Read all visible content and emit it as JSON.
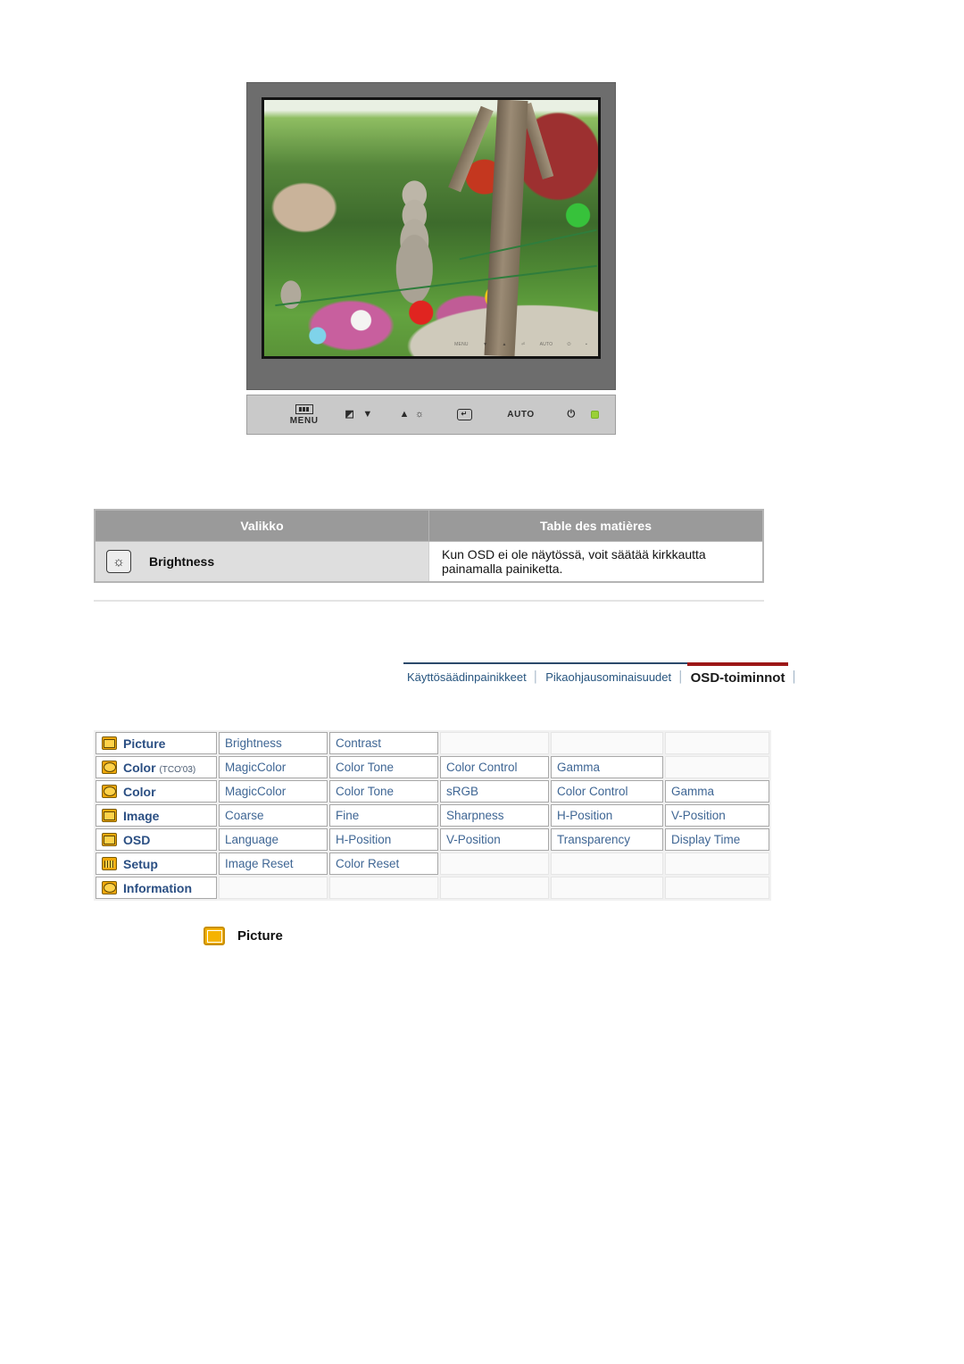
{
  "monitor": {
    "panel_buttons": [
      {
        "label": "MENU",
        "icon": "menu-bars-icon"
      },
      {
        "label": "",
        "icon": "source-down-arrow-icon"
      },
      {
        "label": "",
        "icon": "up-arrow-brightness-icon"
      },
      {
        "label": "",
        "icon": "enter-icon"
      },
      {
        "label": "AUTO",
        "icon": "auto-label"
      },
      {
        "label": "",
        "icon": "power-icon"
      },
      {
        "label": "",
        "icon": "power-led-indicator"
      }
    ],
    "auto_label": "AUTO",
    "menu_label": "MENU",
    "enter_glyph": "↵",
    "power_glyph": "⏻",
    "down_arrow_glyph": "▼",
    "up_arrow_glyph": "▲",
    "brightness_glyph": "☼",
    "source_glyph": "◩",
    "inline_controls": [
      "MENU",
      "▼",
      "▲",
      "⏎",
      "AUTO",
      "⏻",
      "▪"
    ]
  },
  "summary_table": {
    "headers": {
      "menu": "Valikko",
      "description": "Table des matières"
    },
    "rows": [
      {
        "icon": "brightness-icon",
        "icon_glyph": "☼",
        "label": "Brightness",
        "description": "Kun OSD ei ole näytössä, voit säätää kirkkautta painamalla painiketta."
      }
    ]
  },
  "breadcrumb": {
    "items": [
      {
        "label": "Käyttösäädinpainikkeet",
        "active": false
      },
      {
        "label": "Pikaohjausominaisuudet",
        "active": false
      },
      {
        "label": "OSD-toiminnot",
        "active": true
      }
    ],
    "separator": "│",
    "accent_color": "#9c1717",
    "link_color": "#27557f"
  },
  "osd_table": {
    "rows": [
      {
        "icon": "picture-icon",
        "label": "Picture",
        "suffix": "",
        "items": [
          "Brightness",
          "Contrast",
          "",
          "",
          ""
        ]
      },
      {
        "icon": "color-icon",
        "label": "Color",
        "suffix": "(TCO'03)",
        "items": [
          "MagicColor",
          "Color Tone",
          "Color Control",
          "Gamma",
          ""
        ]
      },
      {
        "icon": "color-icon",
        "label": "Color",
        "suffix": "",
        "items": [
          "MagicColor",
          "Color Tone",
          "sRGB",
          "Color Control",
          "Gamma"
        ]
      },
      {
        "icon": "image-icon",
        "label": "Image",
        "suffix": "",
        "items": [
          "Coarse",
          "Fine",
          "Sharpness",
          "H-Position",
          "V-Position"
        ]
      },
      {
        "icon": "osd-icon",
        "label": "OSD",
        "suffix": "",
        "items": [
          "Language",
          "H-Position",
          "V-Position",
          "Transparency",
          "Display Time"
        ]
      },
      {
        "icon": "setup-icon",
        "label": "Setup",
        "suffix": "",
        "items": [
          "Image Reset",
          "Color Reset",
          "",
          "",
          ""
        ]
      },
      {
        "icon": "information-icon",
        "label": "Information",
        "suffix": "",
        "items": [
          "",
          "",
          "",
          "",
          ""
        ]
      }
    ]
  },
  "picture_section": {
    "icon": "picture-icon",
    "label": "Picture"
  }
}
